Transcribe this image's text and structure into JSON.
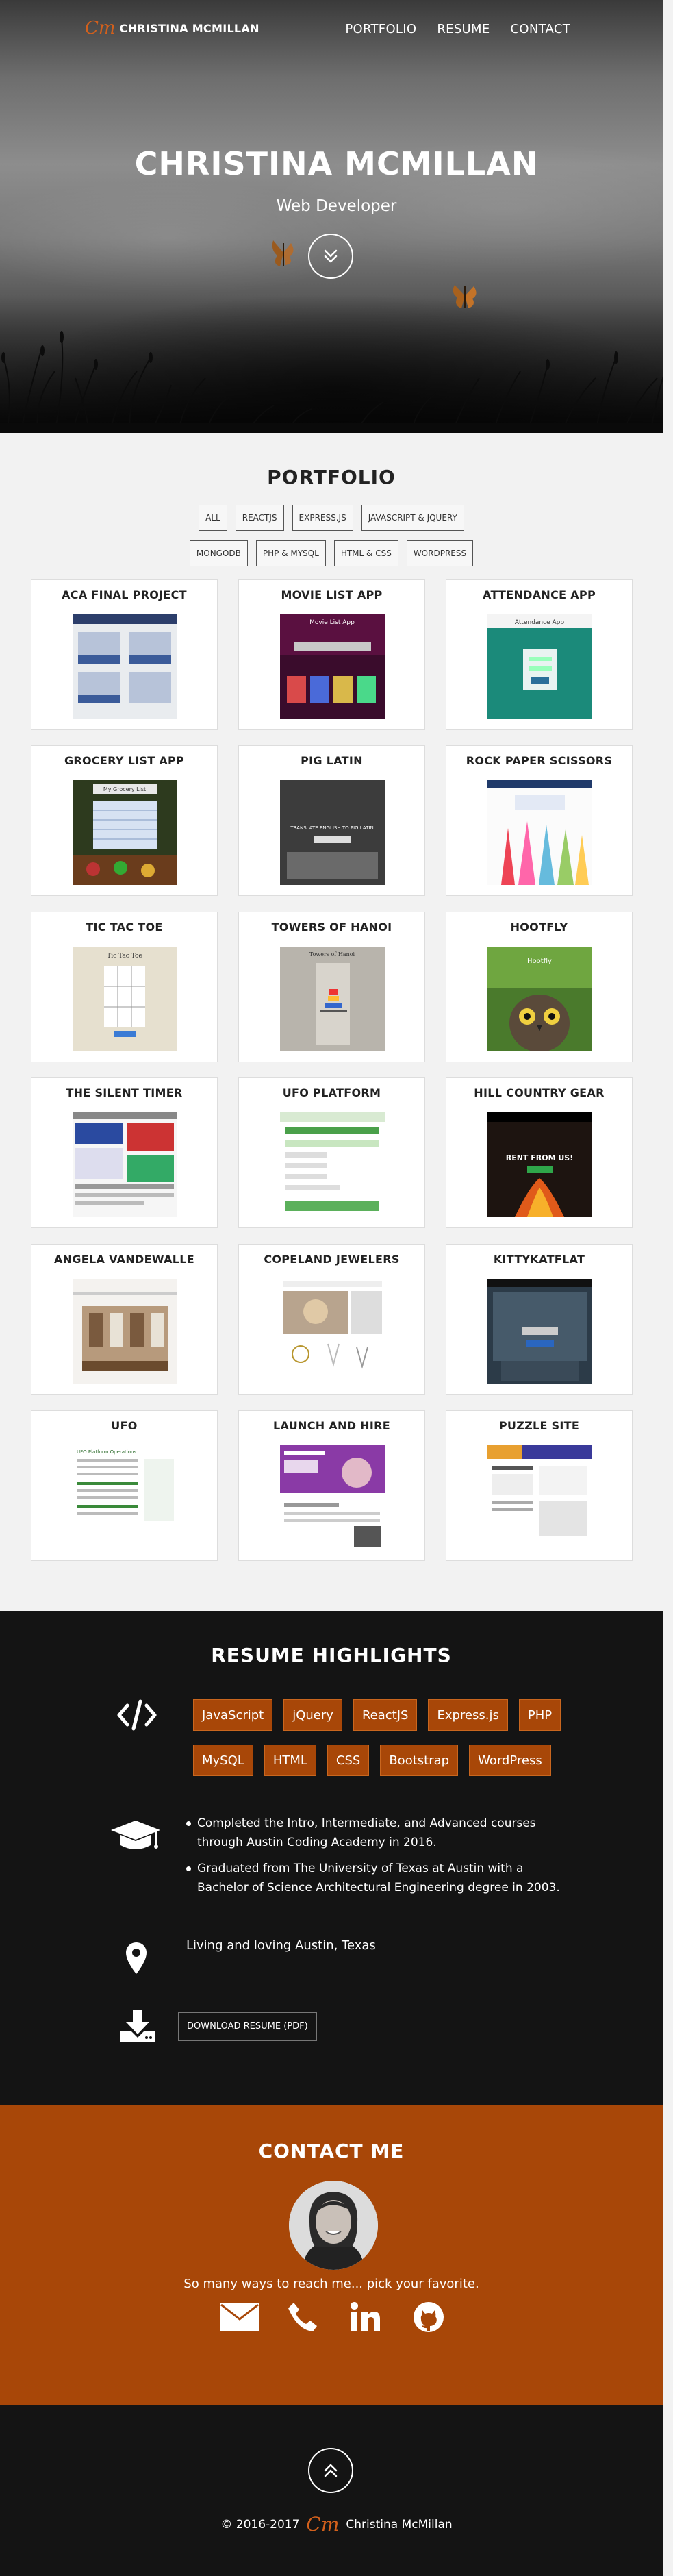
{
  "nav": {
    "logo_mark": "Cm",
    "logo_text": "CHRISTINA MCMILLAN",
    "links": [
      "PORTFOLIO",
      "RESUME",
      "CONTACT"
    ]
  },
  "hero": {
    "title": "CHRISTINA MCMILLAN",
    "subtitle": "Web Developer"
  },
  "portfolio": {
    "title": "PORTFOLIO",
    "filters_row1": [
      "ALL",
      "REACTJS",
      "EXPRESS.JS",
      "JAVASCRIPT & JQUERY"
    ],
    "filters_row2": [
      "MONGODB",
      "PHP & MYSQL",
      "HTML & CSS",
      "WORDPRESS"
    ],
    "projects": [
      "ACA FINAL PROJECT",
      "MOVIE LIST APP",
      "ATTENDANCE APP",
      "GROCERY LIST APP",
      "PIG LATIN",
      "ROCK PAPER SCISSORS",
      "TIC TAC TOE",
      "TOWERS OF HANOI",
      "HOOTFLY",
      "THE SILENT TIMER",
      "UFO PLATFORM",
      "HILL COUNTRY GEAR",
      "ANGELA VANDEWALLE",
      "COPELAND JEWELERS",
      "KITTYKATFLAT",
      "UFO",
      "LAUNCH AND HIRE",
      "PUZZLE SITE"
    ],
    "thumb_text": {
      "movie": "Movie List App",
      "attendance": "Attendance App",
      "grocery": "My Grocery List",
      "pig": "TRANSLATE ENGLISH TO PIG LATIN",
      "tic": "Tic Tac Toe",
      "hanoi": "Towers of Hanoi",
      "hootfly": "Hootfly",
      "hill": "RENT FROM US!",
      "ufo": "UFO Platform Operations"
    }
  },
  "resume": {
    "title": "RESUME HIGHLIGHTS",
    "skills_row1": [
      "JavaScript",
      "jQuery",
      "ReactJS",
      "Express.js",
      "PHP"
    ],
    "skills_row2": [
      "MySQL",
      "HTML",
      "CSS",
      "Bootstrap",
      "WordPress"
    ],
    "education": [
      "Completed the Intro, Intermediate, and Advanced courses through Austin Coding Academy in 2016.",
      "Graduated from The University of Texas at Austin with a Bachelor of Science Architectural Engineering degree in 2003."
    ],
    "location": "Living and loving Austin, Texas",
    "download_label": "DOWNLOAD RESUME (PDF)"
  },
  "contact": {
    "title": "CONTACT ME",
    "tagline": "So many ways to reach me... pick your favorite."
  },
  "footer": {
    "copyright": "© 2016-2017",
    "logo_mark": "Cm",
    "name": "Christina McMillan"
  },
  "colors": {
    "accent": "#a84708",
    "dark": "#141414",
    "light": "#f2f2f2"
  }
}
